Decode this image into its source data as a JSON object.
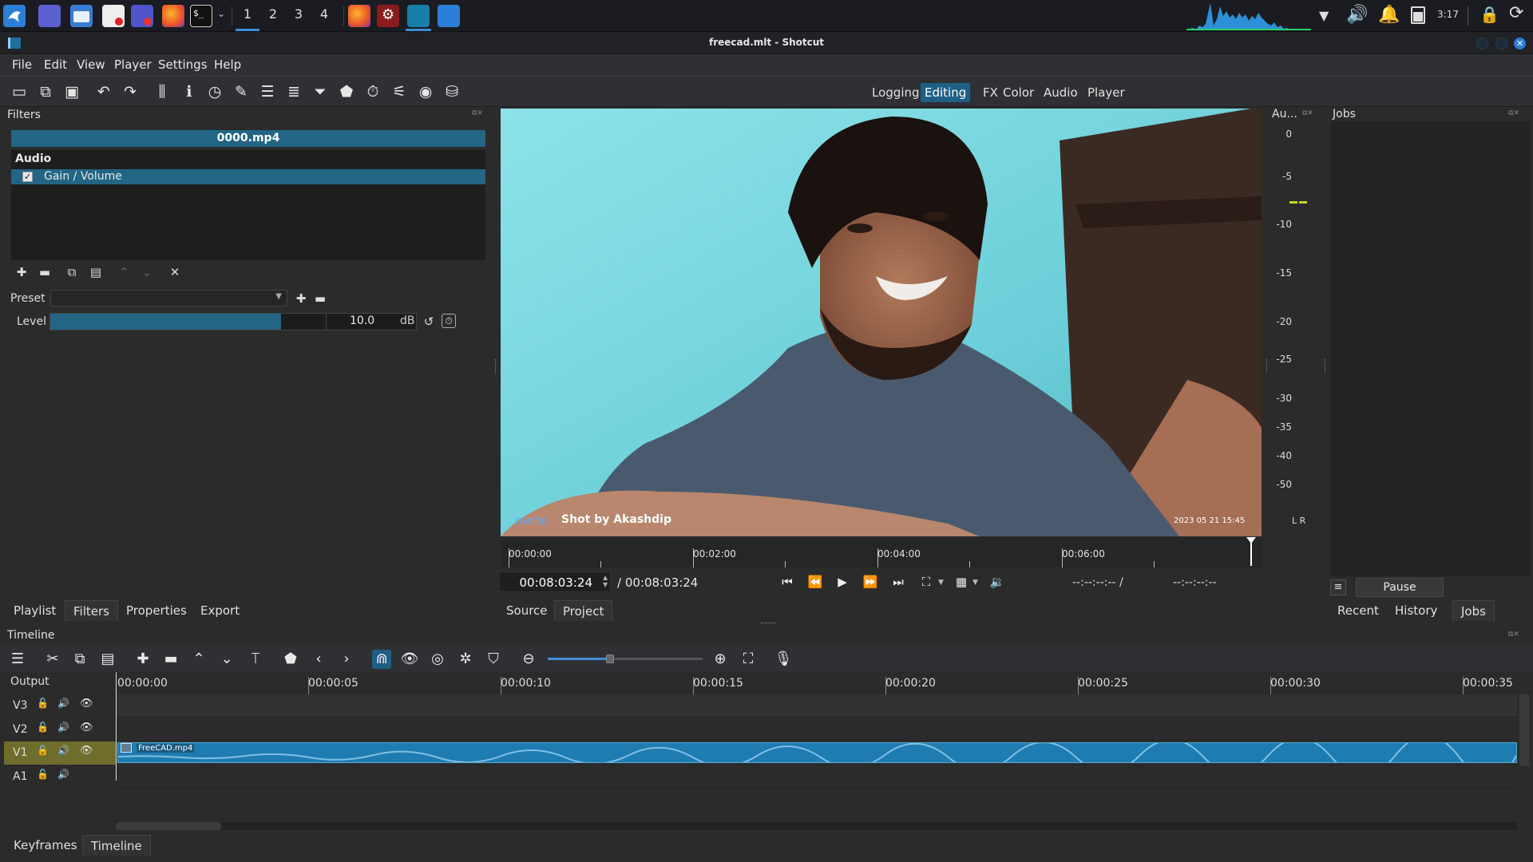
{
  "taskbar": {
    "workspaces": [
      "1",
      "2",
      "3",
      "4"
    ],
    "clock": "3:17"
  },
  "window": {
    "title": "freecad.mlt - Shotcut"
  },
  "menu": [
    {
      "label": "File"
    },
    {
      "label": "Edit"
    },
    {
      "label": "View"
    },
    {
      "label": "Player"
    },
    {
      "label": "Settings"
    },
    {
      "label": "Help"
    }
  ],
  "layouts": {
    "tabs": [
      "Logging",
      "Editing",
      "FX",
      "Color",
      "Audio",
      "Player"
    ],
    "active": "Editing"
  },
  "filters": {
    "dock_title": "Filters",
    "clip_name": "0000.mp4",
    "section": "Audio",
    "filter_item": "Gain / Volume",
    "filter_checked": true,
    "preset_label": "Preset",
    "level_label": "Level",
    "level_value": "10.0",
    "level_unit": "dB",
    "level_fraction": 0.63
  },
  "left_tabs": [
    "Playlist",
    "Filters",
    "Properties",
    "Export"
  ],
  "left_tabs_active": "Filters",
  "player": {
    "watermark_brand": "narzo",
    "watermark_text": "Shot by Akashdip",
    "watermark_date": "2023 05 21 15:45",
    "ruler": [
      "00:00:00",
      "00:02:00",
      "00:04:00",
      "00:06:00"
    ],
    "position": "00:08:03:24",
    "duration": "/ 00:08:03:24",
    "in_point": "--:--:--:-- /",
    "out_point": "--:--:--:--",
    "tabs": [
      "Source",
      "Project"
    ]
  },
  "audio_meter": {
    "title": "Au...",
    "scale": [
      "0",
      "-5",
      "-10",
      "-15",
      "-20",
      "-25",
      "-30",
      "-35",
      "-40",
      "-50"
    ],
    "channels": "L  R"
  },
  "jobs": {
    "title": "Jobs",
    "pause_label": "Pause",
    "tabs": [
      "Recent",
      "History",
      "Jobs"
    ],
    "active_tab": "Jobs"
  },
  "timeline": {
    "title": "Timeline",
    "output_label": "Output",
    "ruler": [
      "00:00:00",
      "00:00:05",
      "00:00:10",
      "00:00:15",
      "00:00:20",
      "00:00:25",
      "00:00:30",
      "00:00:35"
    ],
    "tracks": [
      "V3",
      "V2",
      "V1",
      "A1"
    ],
    "clip_name": "FreeCAD.mp4",
    "zoom_fraction": 0.4
  },
  "bottom_tabs": [
    "Keyframes",
    "Timeline"
  ],
  "colors": {
    "accent": "#226584",
    "clip": "#1e7cb0",
    "selected_track": "#6e6d2c"
  }
}
